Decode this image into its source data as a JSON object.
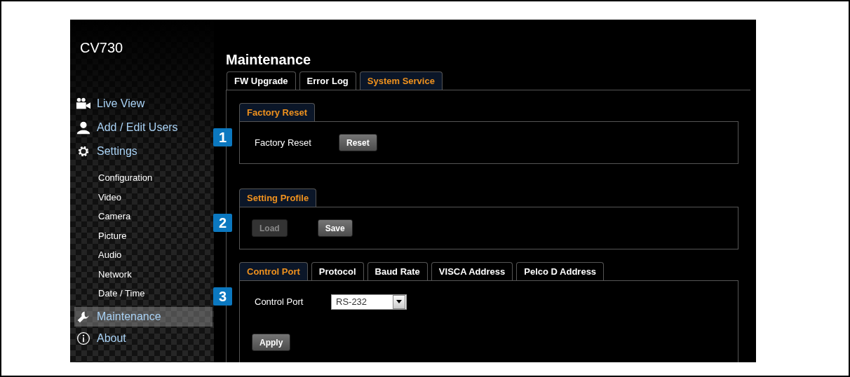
{
  "product": "CV730",
  "nav": [
    {
      "label": "Live View",
      "selected": false
    },
    {
      "label": "Add / Edit Users",
      "selected": false
    },
    {
      "label": "Settings",
      "selected": false,
      "children": [
        {
          "label": "Configuration",
          "selected": false
        },
        {
          "label": "Video",
          "selected": false
        },
        {
          "label": "Camera",
          "selected": false
        },
        {
          "label": "Picture",
          "selected": false
        },
        {
          "label": "Audio",
          "selected": false
        },
        {
          "label": "Network",
          "selected": false
        },
        {
          "label": "Date / Time",
          "selected": false
        }
      ]
    },
    {
      "label": "Maintenance",
      "selected": true
    },
    {
      "label": "About",
      "selected": false
    }
  ],
  "page_title": "Maintenance",
  "tabs": [
    {
      "label": "FW Upgrade",
      "selected": false
    },
    {
      "label": "Error Log",
      "selected": false
    },
    {
      "label": "System Service",
      "selected": true
    }
  ],
  "sections": [
    {
      "callout": "1",
      "tabs": [
        {
          "label": "Factory Reset",
          "selected": true
        }
      ],
      "rows": [
        [
          {
            "kind": "label",
            "text": "Factory Reset"
          },
          {
            "kind": "button",
            "label": "Reset",
            "disabled": false
          }
        ]
      ]
    },
    {
      "callout": "2",
      "tabs": [
        {
          "label": "Setting Profile",
          "selected": true
        }
      ],
      "rows": [
        [
          {
            "kind": "button",
            "label": "Load",
            "disabled": true
          },
          {
            "kind": "button",
            "label": "Save",
            "disabled": false
          }
        ]
      ]
    },
    {
      "callout": "3",
      "tabs": [
        {
          "label": "Control Port",
          "selected": true
        },
        {
          "label": "Protocol",
          "selected": false
        },
        {
          "label": "Baud Rate",
          "selected": false
        },
        {
          "label": "VISCA Address",
          "selected": false
        },
        {
          "label": "Pelco D Address",
          "selected": false
        }
      ],
      "rows": [
        [
          {
            "kind": "label",
            "text": "Control Port"
          },
          {
            "kind": "select",
            "value": "RS-232"
          }
        ],
        [
          {
            "kind": "button",
            "label": "Apply",
            "disabled": false
          }
        ]
      ]
    }
  ]
}
